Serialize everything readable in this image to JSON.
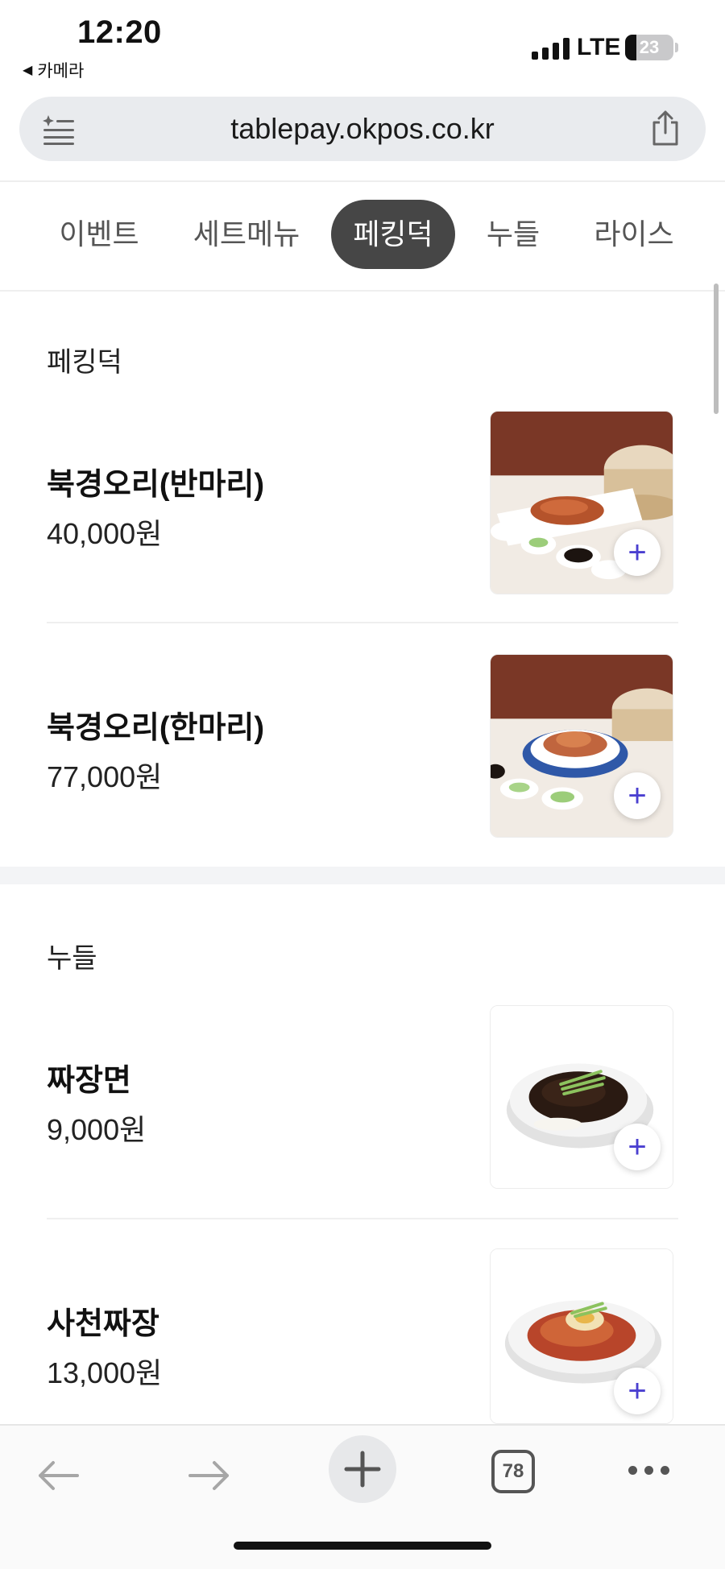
{
  "status": {
    "time": "12:20",
    "back_app": "카메라",
    "network": "LTE",
    "battery": "23",
    "battery_level_percent": 23
  },
  "browser": {
    "url": "tablepay.okpos.co.kr",
    "reader_icon": "reader-mode-icon",
    "share_icon": "share-icon"
  },
  "tabs": [
    {
      "label": "이벤트",
      "active": false
    },
    {
      "label": "세트메뉴",
      "active": false
    },
    {
      "label": "페킹덕",
      "active": true
    },
    {
      "label": "누들",
      "active": false
    },
    {
      "label": "라이스",
      "active": false
    }
  ],
  "sections": [
    {
      "title": "페킹덕",
      "items": [
        {
          "name": "북경오리(반마리)",
          "price": "40,000원",
          "add": "+"
        },
        {
          "name": "북경오리(한마리)",
          "price": "77,000원",
          "add": "+"
        }
      ]
    },
    {
      "title": "누들",
      "items": [
        {
          "name": "짜장면",
          "price": "9,000원",
          "add": "+"
        },
        {
          "name": "사천짜장",
          "price": "13,000원",
          "add": "+"
        }
      ]
    }
  ],
  "toolbar": {
    "tab_count": "78",
    "back_icon": "back-arrow-icon",
    "forward_icon": "forward-arrow-icon",
    "new_tab_icon": "plus-icon",
    "more_icon": "more-dots-icon"
  },
  "colors": {
    "active_tab": "#464646",
    "add_button": "#4a3fd0",
    "section_gap": "#f3f4f6"
  }
}
